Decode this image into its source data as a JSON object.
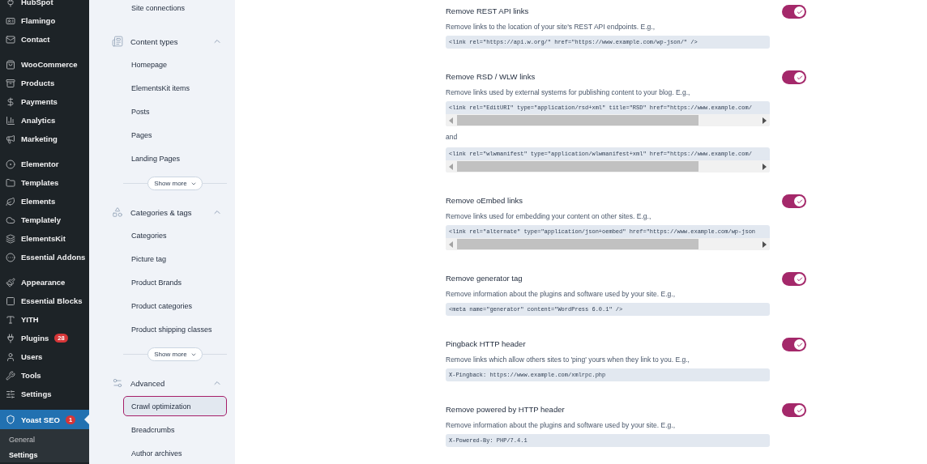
{
  "admin_menu": {
    "groups": [
      {
        "items": [
          {
            "label": "HubSpot",
            "selected": false
          },
          {
            "label": "Flamingo",
            "selected": false
          },
          {
            "label": "Contact",
            "selected": false
          }
        ]
      },
      {
        "items": [
          {
            "label": "WooCommerce",
            "selected": false
          },
          {
            "label": "Products",
            "selected": false
          },
          {
            "label": "Payments",
            "selected": false
          },
          {
            "label": "Analytics",
            "selected": false
          },
          {
            "label": "Marketing",
            "selected": false
          }
        ]
      },
      {
        "items": [
          {
            "label": "Elementor",
            "selected": false
          },
          {
            "label": "Templates",
            "selected": false
          },
          {
            "label": "Elements",
            "selected": false
          },
          {
            "label": "Templately",
            "selected": false
          },
          {
            "label": "ElementsKit",
            "selected": false
          },
          {
            "label": "Essential Addons",
            "selected": false
          }
        ]
      },
      {
        "items": [
          {
            "label": "Appearance",
            "selected": false
          },
          {
            "label": "Essential Blocks",
            "selected": false
          },
          {
            "label": "YITH",
            "selected": false
          },
          {
            "label": "Plugins",
            "selected": false,
            "badge": "28"
          },
          {
            "label": "Users",
            "selected": false
          },
          {
            "label": "Tools",
            "selected": false
          },
          {
            "label": "Settings",
            "selected": false
          }
        ]
      }
    ],
    "current": {
      "label": "Yoast SEO",
      "selected": true,
      "badge": "1",
      "submenu": [
        {
          "label": "General",
          "selected": false
        },
        {
          "label": "Settings",
          "selected": true
        }
      ]
    }
  },
  "yoast_nav": {
    "top_items": [
      {
        "label": "Site connections",
        "selected": false
      }
    ],
    "sections": [
      {
        "title": "Content types",
        "expanded": true,
        "items": [
          {
            "label": "Homepage",
            "selected": false
          },
          {
            "label": "ElementsKit items",
            "selected": false
          },
          {
            "label": "Posts",
            "selected": false
          },
          {
            "label": "Pages",
            "selected": false
          },
          {
            "label": "Landing Pages",
            "selected": false
          }
        ],
        "show_more": "Show more"
      },
      {
        "title": "Categories & tags",
        "expanded": true,
        "items": [
          {
            "label": "Categories",
            "selected": false
          },
          {
            "label": "Picture tag",
            "selected": false
          },
          {
            "label": "Product Brands",
            "selected": false
          },
          {
            "label": "Product categories",
            "selected": false
          },
          {
            "label": "Product shipping classes",
            "selected": false
          }
        ],
        "show_more": "Show more"
      },
      {
        "title": "Advanced",
        "expanded": true,
        "items": [
          {
            "label": "Crawl optimization",
            "selected": true
          },
          {
            "label": "Breadcrumbs",
            "selected": false
          },
          {
            "label": "Author archives",
            "selected": false
          }
        ]
      }
    ]
  },
  "settings": [
    {
      "title": "Remove REST API links",
      "on": true,
      "description": "Remove links to the location of your site's REST API endpoints. E.g.,",
      "blocks": [
        {
          "kind": "code",
          "text": "<link rel=\"https://api.w.org/\" href=\"https://www.example.com/wp-json/\" />"
        }
      ]
    },
    {
      "title": "Remove RSD / WLW links",
      "on": true,
      "description": "Remove links used by external systems for publishing content to your blog. E.g.,",
      "blocks": [
        {
          "kind": "code",
          "text": "<link rel=\"EditURI\" type=\"application/rsd+xml\" title=\"RSD\" href=\"https://www.example.com/",
          "scroll": true
        },
        {
          "kind": "text",
          "text": "and"
        },
        {
          "kind": "code",
          "text": "<link rel=\"wlwmanifest\" type=\"application/wlwmanifest+xml\" href=\"https://www.example.com/",
          "scroll": true
        }
      ]
    },
    {
      "title": "Remove oEmbed links",
      "on": true,
      "description": "Remove links used for embedding your content on other sites. E.g.,",
      "blocks": [
        {
          "kind": "code",
          "text": "<link rel=\"alternate\" type=\"application/json+oembed\" href=\"https://www.example.com/wp-json",
          "scroll": true
        }
      ]
    },
    {
      "title": "Remove generator tag",
      "on": true,
      "description": "Remove information about the plugins and software used by your site. E.g.,",
      "blocks": [
        {
          "kind": "code",
          "text": "<meta name=\"generator\" content=\"WordPress 6.0.1\" />"
        }
      ]
    },
    {
      "title": "Pingback HTTP header",
      "on": true,
      "description": "Remove links which allow others sites to 'ping' yours when they link to you. E.g.,",
      "blocks": [
        {
          "kind": "code",
          "text": "X-Pingback: https://www.example.com/xmlrpc.php"
        }
      ]
    },
    {
      "title": "Remove powered by HTTP header",
      "on": true,
      "description": "Remove information about the plugins and software used by your site. E.g.,",
      "blocks": [
        {
          "kind": "code",
          "text": "X-Powered-By: PHP/7.4.1"
        }
      ]
    }
  ]
}
